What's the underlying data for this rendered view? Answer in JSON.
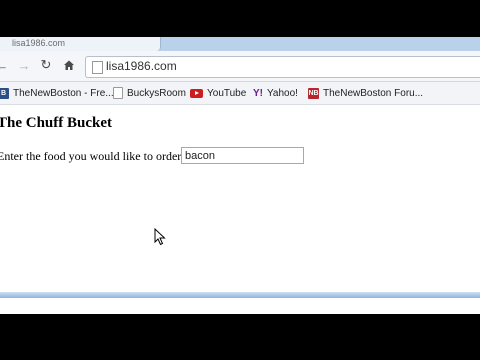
{
  "browser": {
    "tab": {
      "title": "lisa1986.com"
    },
    "address_bar": {
      "url": "lisa1986.com"
    },
    "nav": {
      "back_icon": "arrow-left-icon",
      "forward_icon": "arrow-right-icon",
      "reload_icon": "reload-icon",
      "home_icon": "home-icon"
    },
    "bookmarks": [
      {
        "label": "TheNewBoston - Fre...",
        "icon": "thenewboston-favicon"
      },
      {
        "label": "BuckysRoom",
        "icon": "page-favicon"
      },
      {
        "label": "YouTube",
        "icon": "youtube-favicon"
      },
      {
        "label": "Yahoo!",
        "icon": "yahoo-favicon"
      },
      {
        "label": "TheNewBoston Foru...",
        "icon": "thenewboston-forum-favicon"
      }
    ]
  },
  "page": {
    "heading": "The Chuff Bucket",
    "form": {
      "label": "Enter the food you would like to order:",
      "food_value": "bacon"
    }
  }
}
